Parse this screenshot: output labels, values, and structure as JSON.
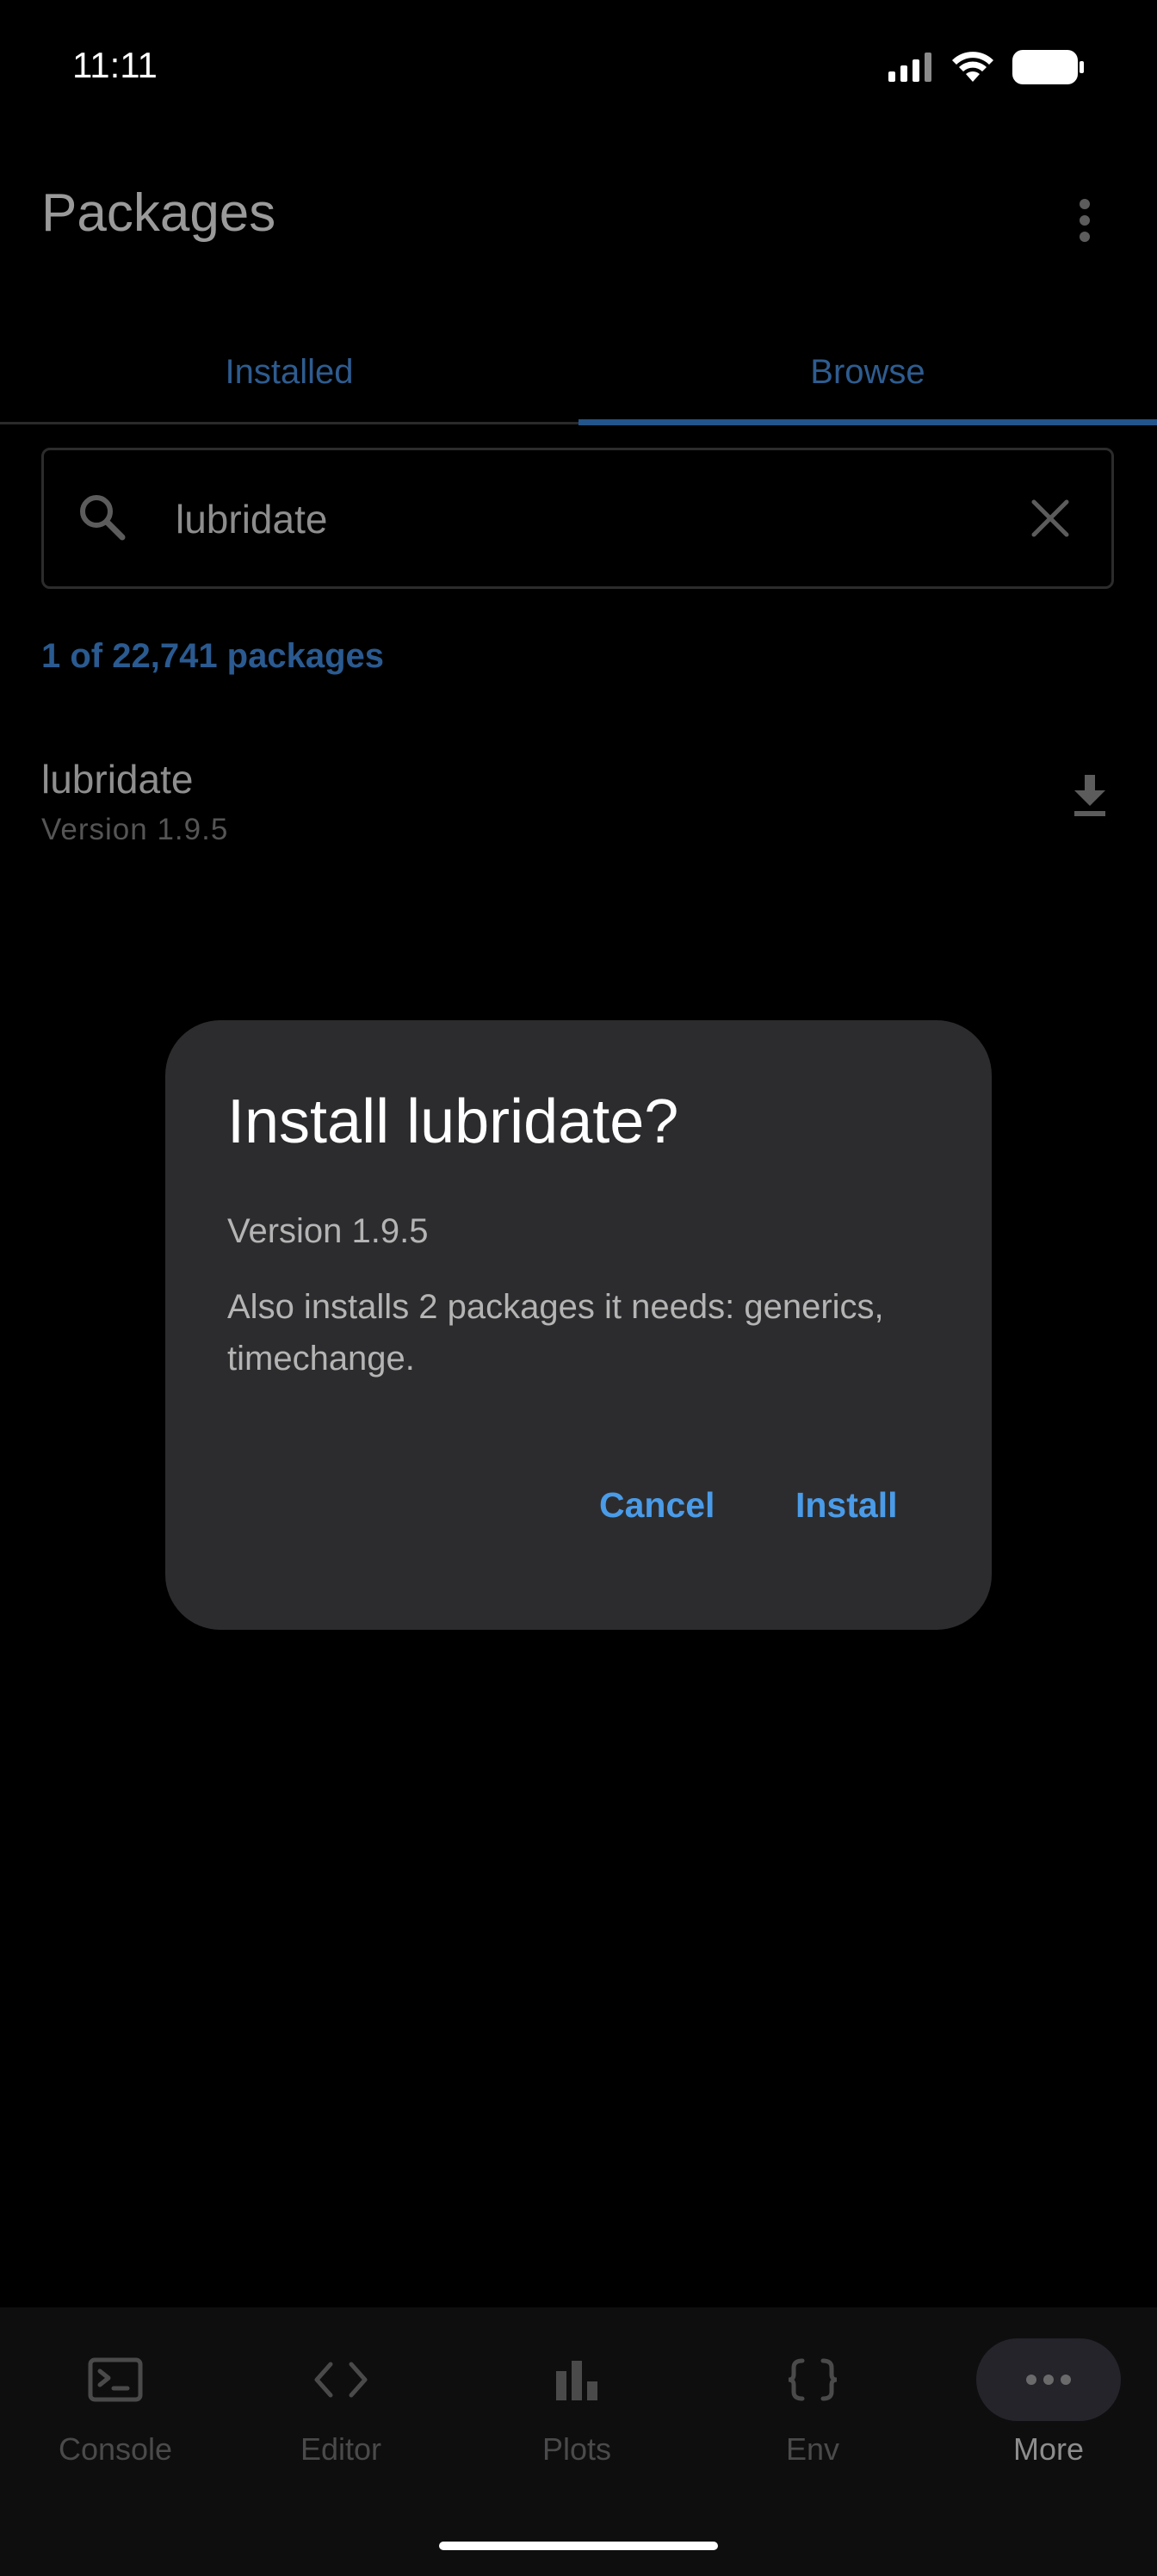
{
  "status_bar": {
    "time": "11:11"
  },
  "app_bar": {
    "title": "Packages"
  },
  "tabs": [
    {
      "label": "Installed"
    },
    {
      "label": "Browse",
      "selected": true
    }
  ],
  "search": {
    "value": "lubridate"
  },
  "result_count": "1 of 22,741 packages",
  "packages": [
    {
      "name": "lubridate",
      "version": "Version 1.9.5"
    }
  ],
  "dialog": {
    "title": "Install lubridate?",
    "version": "Version 1.9.5",
    "body": "Also installs 2 packages it needs: generics, timechange.",
    "cancel_label": "Cancel",
    "install_label": "Install"
  },
  "bottom_nav": [
    {
      "label": "Console",
      "icon": "console-icon"
    },
    {
      "label": "Editor",
      "icon": "code-icon"
    },
    {
      "label": "Plots",
      "icon": "bar-chart-icon"
    },
    {
      "label": "Env",
      "icon": "braces-icon"
    },
    {
      "label": "More",
      "icon": "more-horizontal-icon",
      "selected": true
    }
  ],
  "colors": {
    "accent": "#4a9be8",
    "tab_dimmed": "#2e5c8f",
    "dialog_bg": "#2c2c2e",
    "background": "#000000"
  }
}
